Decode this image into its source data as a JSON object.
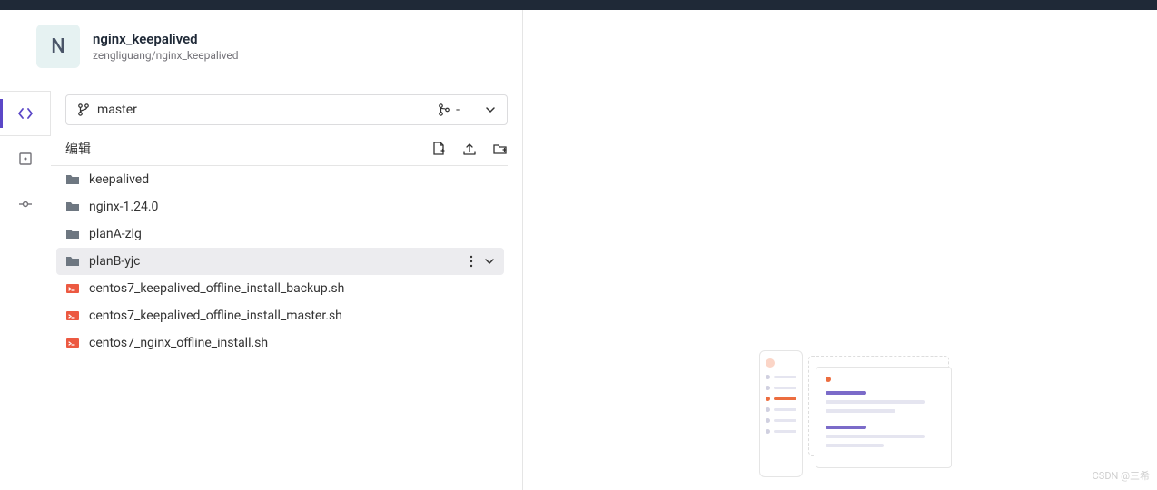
{
  "project": {
    "avatar_letter": "N",
    "name": "nginx_keepalived",
    "path": "zengliguang/nginx_keepalived"
  },
  "branch": {
    "name": "master",
    "merge_text": "-"
  },
  "edit": {
    "label": "编辑"
  },
  "files": [
    {
      "type": "folder",
      "name": "keepalived"
    },
    {
      "type": "folder",
      "name": "nginx-1.24.0"
    },
    {
      "type": "folder",
      "name": "planA-zlg"
    },
    {
      "type": "folder",
      "name": "planB-yjc",
      "hovered": true
    },
    {
      "type": "script",
      "name": "centos7_keepalived_offline_install_backup.sh"
    },
    {
      "type": "script",
      "name": "centos7_keepalived_offline_install_master.sh"
    },
    {
      "type": "script",
      "name": "centos7_nginx_offline_install.sh"
    }
  ],
  "watermark": "CSDN @三希"
}
